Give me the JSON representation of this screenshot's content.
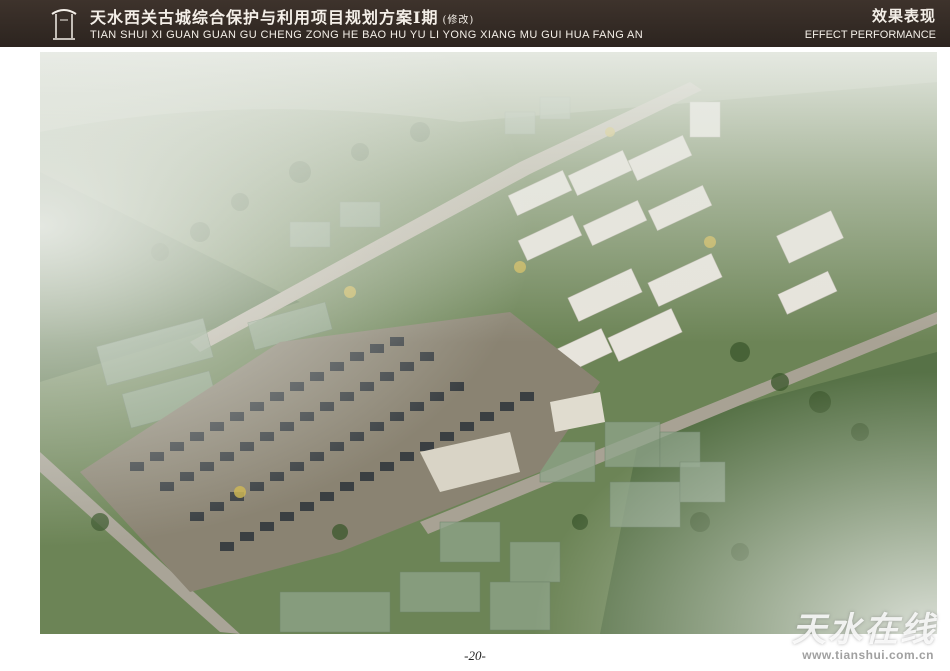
{
  "header": {
    "title_cn": "天水西关古城综合保护与利用项目规划方案Ⅰ期",
    "revision": "(修改)",
    "title_en": "TIAN SHUI XI GUAN GUAN GU CHENG ZONG HE BAO HU YU LI YONG XIANG MU GUI HUA FANG AN",
    "section_cn": "效果表现",
    "section_en": "EFFECT PERFORMANCE",
    "background": "#342b25"
  },
  "image": {
    "subject": "aerial-rendering"
  },
  "page": {
    "number": "-20-"
  },
  "watermark": {
    "text_cn": "天水在线",
    "url": "www.tianshui.com.cn"
  }
}
